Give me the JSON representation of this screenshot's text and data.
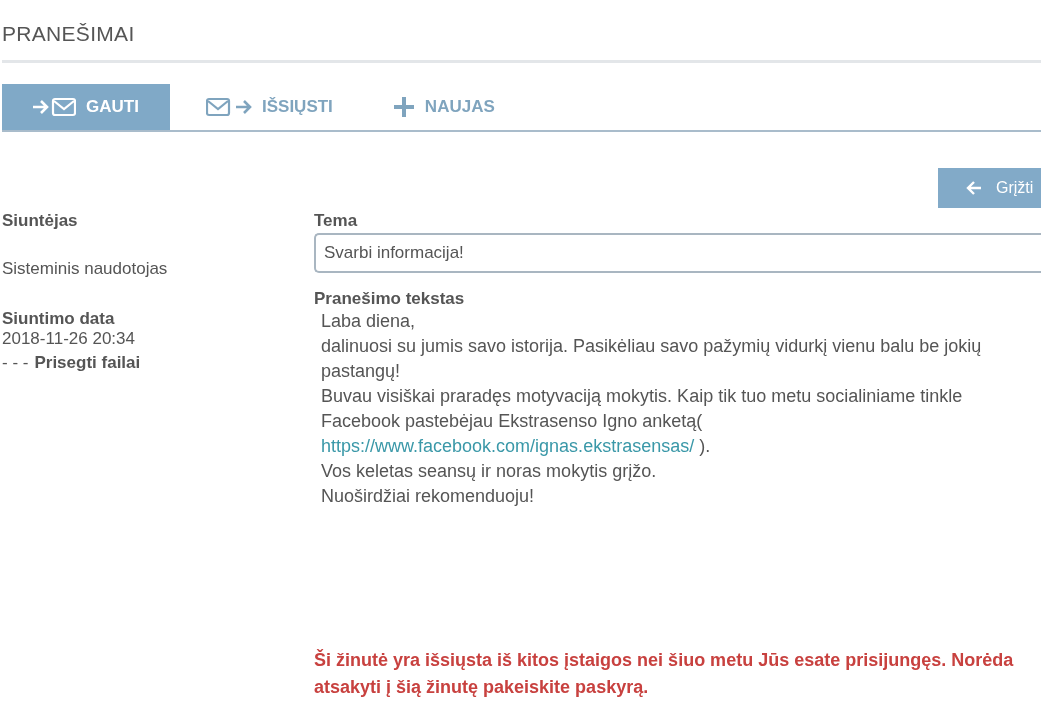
{
  "page_title": "PRANEŠIMAI",
  "tabs": [
    {
      "label": "GAUTI",
      "kind": "inbox",
      "selected": true
    },
    {
      "label": "IŠSIŲSTI",
      "kind": "outbox",
      "selected": false
    },
    {
      "label": "NAUJAS",
      "kind": "new",
      "selected": false
    }
  ],
  "back_button": {
    "label": "Grįžti"
  },
  "sender": {
    "label": "Siuntėjas",
    "value": "Sisteminis naudotojas"
  },
  "sent_date": {
    "label": "Siuntimo data",
    "value": "2018-11-26 20:34"
  },
  "attachments": {
    "prefix": "- - -",
    "label": "Prisegti failai"
  },
  "subject": {
    "label": "Tema",
    "value": "Svarbi informacija!"
  },
  "message": {
    "label": "Pranešimo tekstas",
    "lines": [
      {
        "kind": "text",
        "text": "Laba diena,"
      },
      {
        "kind": "text",
        "text": "dalinuosi su jumis savo istorija. Pasikėliau savo pažymių vidurkį vienu balu be jokių"
      },
      {
        "kind": "text",
        "text": "pastangų!"
      },
      {
        "kind": "text",
        "text": "Buvau visiškai praradęs motyvaciją mokytis. Kaip tik tuo metu socialiniame tinkle"
      },
      {
        "kind": "text",
        "text": "Facebook pastebėjau Ekstrasenso Igno anketą("
      },
      {
        "kind": "link",
        "text": "https://www.facebook.com/ignas.ekstrasensas/",
        "after": " )."
      },
      {
        "kind": "text",
        "text": "Vos keletas seansų ir noras mokytis grįžo."
      },
      {
        "kind": "text",
        "text": "Nuoširdžiai rekomenduoju!"
      }
    ]
  },
  "warning": {
    "lines": [
      "Ši žinutė yra išsiųsta iš kitos įstaigos nei šiuo metu Jūs esate prisijungęs. Norėda",
      "atsakyti į šią žinutę pakeiskite paskyrą."
    ]
  }
}
